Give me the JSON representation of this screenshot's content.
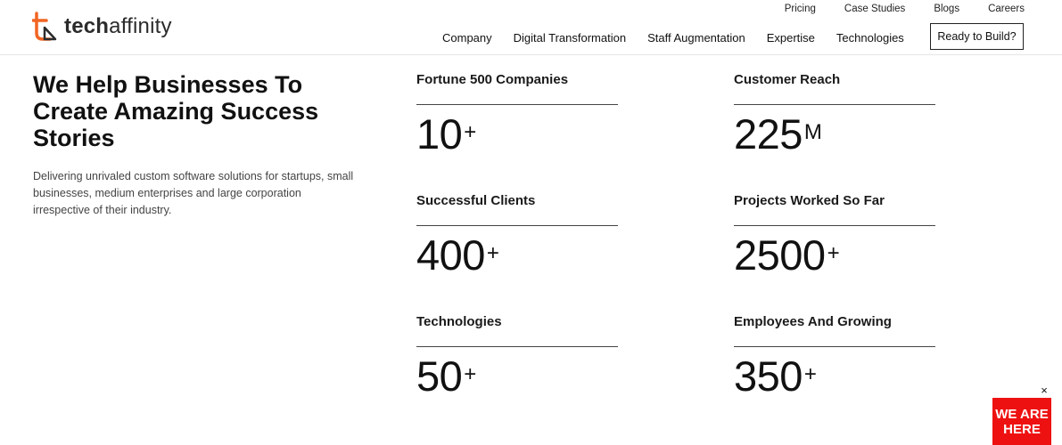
{
  "logo": {
    "text_part1": "tech",
    "text_part2": "affinity"
  },
  "top_nav": [
    "Pricing",
    "Case Studies",
    "Blogs",
    "Careers"
  ],
  "main_nav": [
    "Company",
    "Digital Transformation",
    "Staff Augmentation",
    "Expertise",
    "Technologies"
  ],
  "cta_label": "Ready to Build?",
  "hero": {
    "title": "We Help Businesses To Create Amazing Success Stories",
    "description": "Delivering unrivaled custom software solutions for startups, small businesses, medium enterprises and large corporation irrespective of their industry."
  },
  "stats": [
    {
      "label": "Fortune 500 Companies",
      "value": "10",
      "suffix": "+"
    },
    {
      "label": "Customer Reach",
      "value": "225",
      "suffix": "M"
    },
    {
      "label": "Successful Clients",
      "value": "400",
      "suffix": "+"
    },
    {
      "label": "Projects Worked So Far",
      "value": "2500",
      "suffix": "+"
    },
    {
      "label": "Technologies",
      "value": "50",
      "suffix": "+"
    },
    {
      "label": "Employees And Growing",
      "value": "350",
      "suffix": "+"
    }
  ],
  "badge": {
    "line1": "WE ARE",
    "line2": "HERE",
    "close": "×"
  },
  "colors": {
    "logo_orange": "#f26522",
    "badge_red": "#ee1111"
  }
}
